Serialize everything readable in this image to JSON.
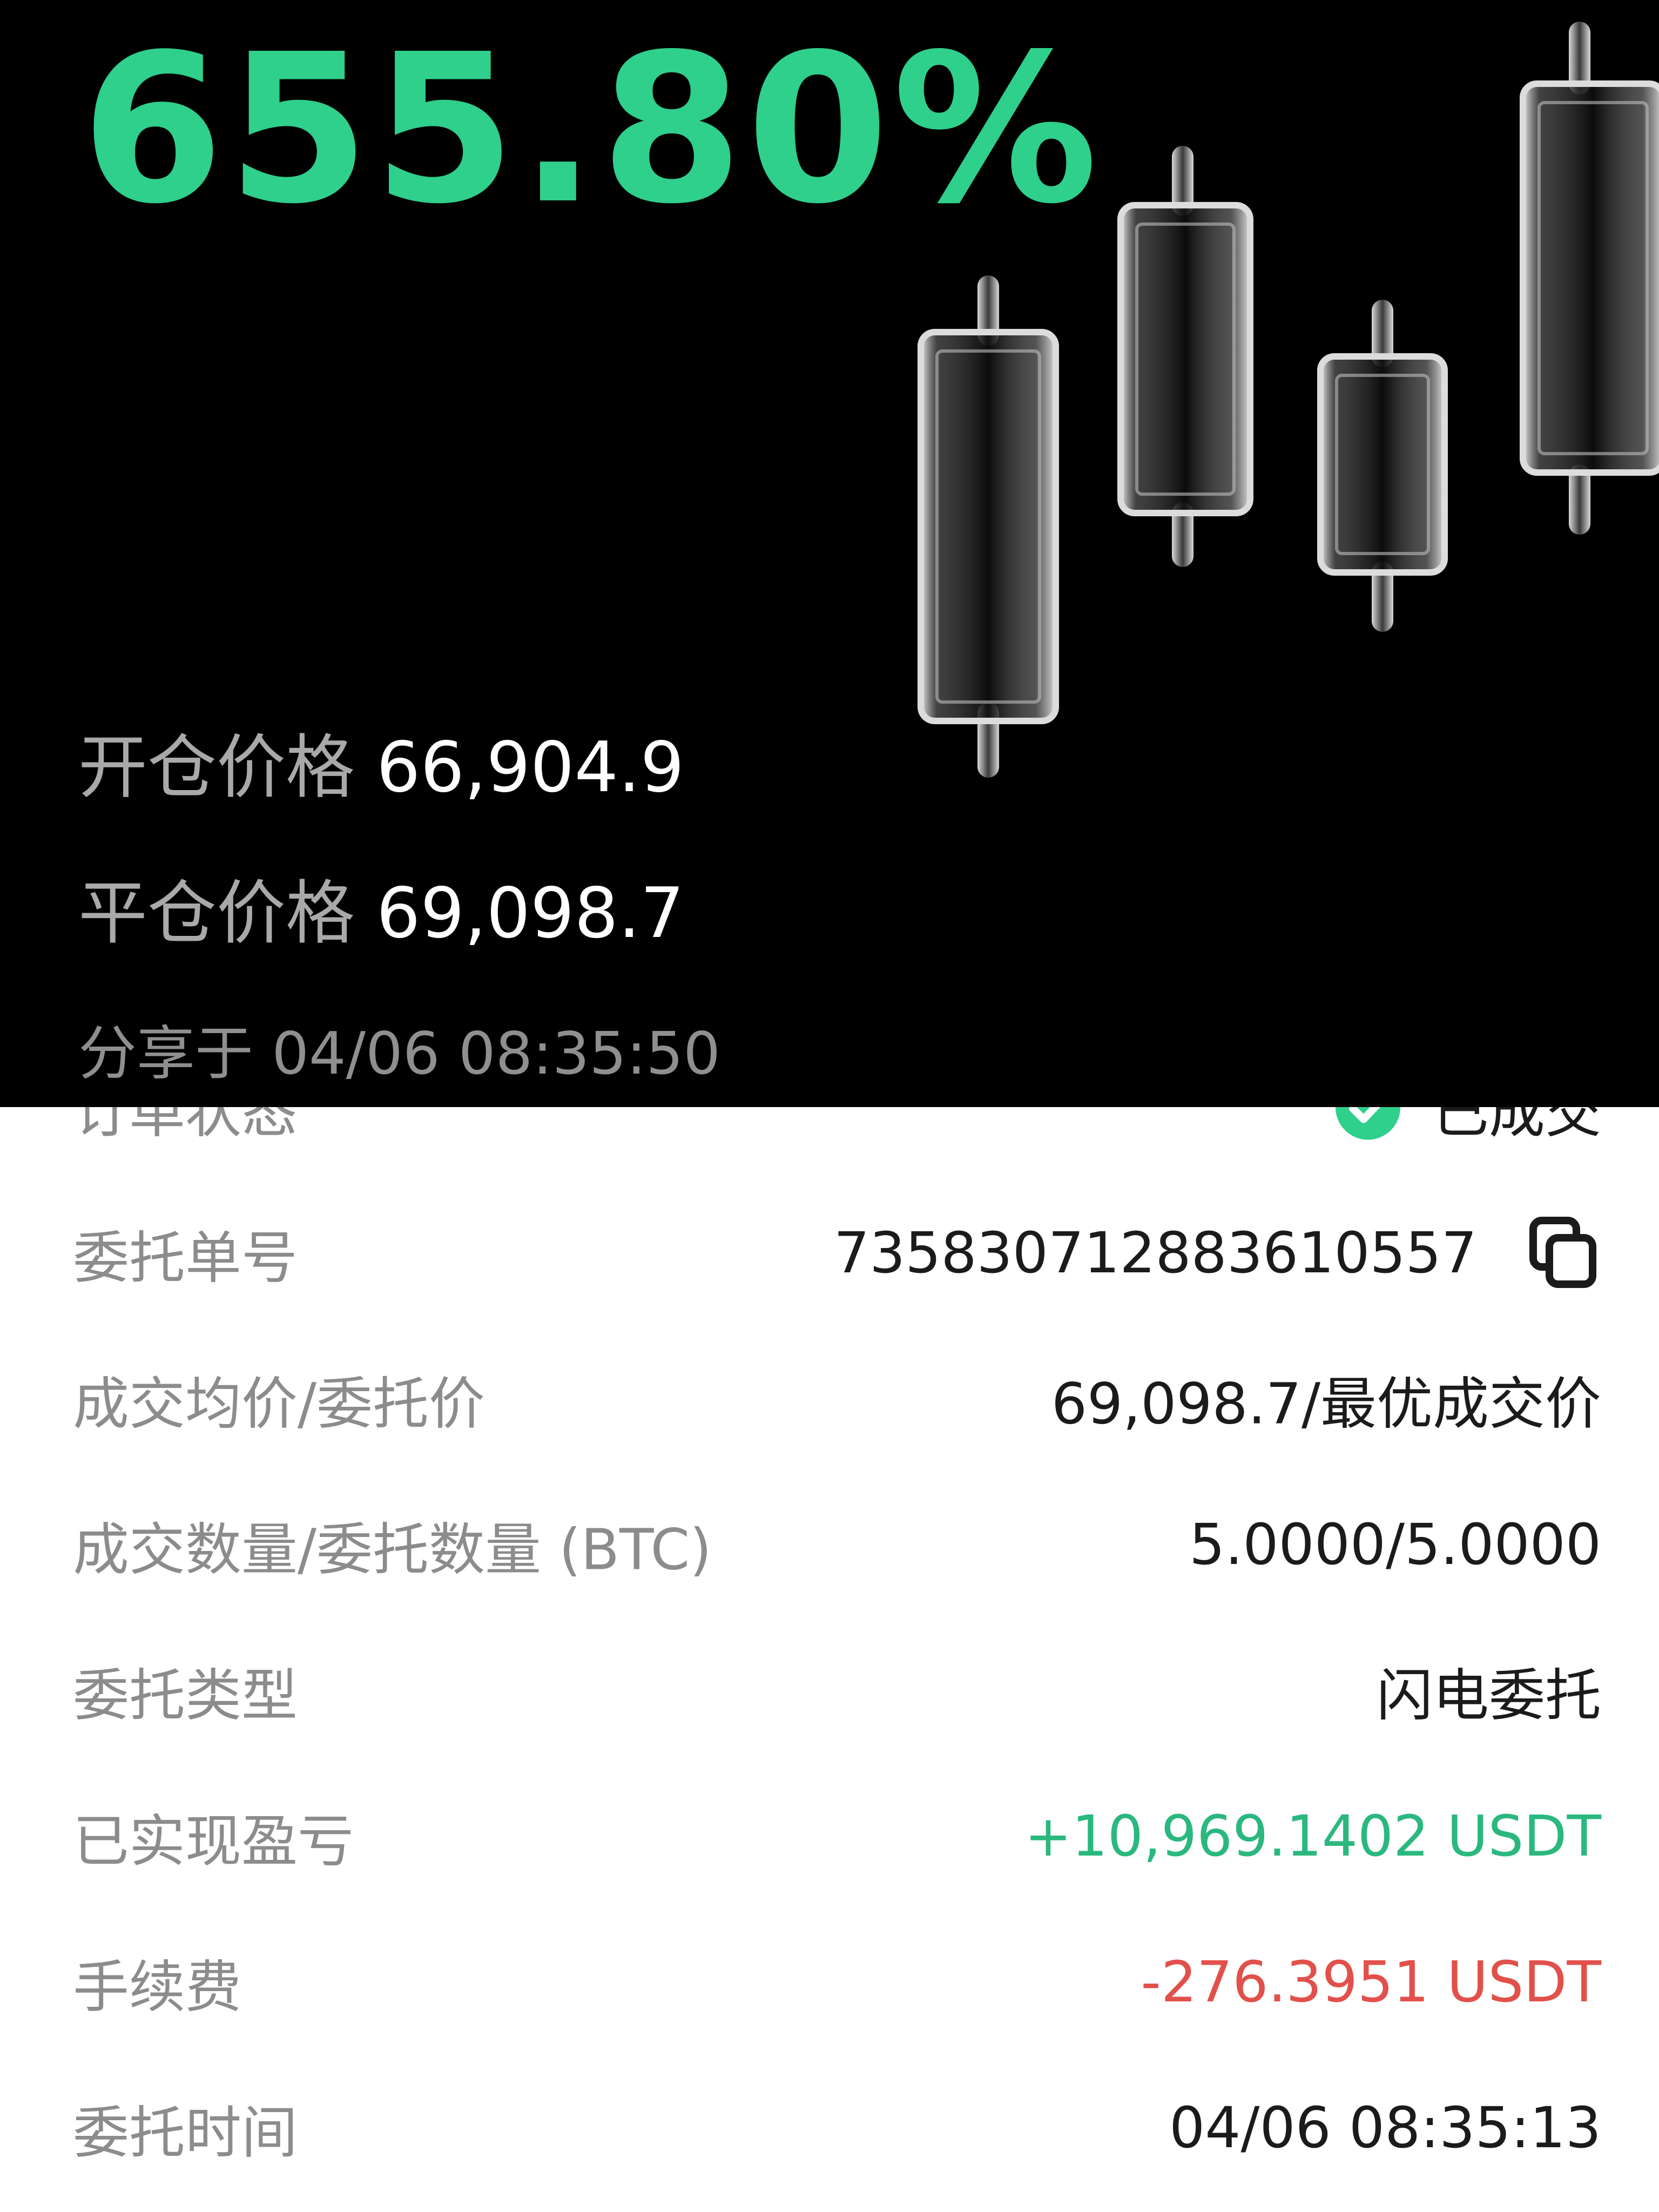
{
  "share_card": {
    "roi": "655.80%",
    "open_price_label": "开仓价格",
    "open_price_value": "66,904.9",
    "close_price_label": "平仓价格",
    "close_price_value": "69,098.7",
    "shared_at": "分享于 04/06 08:35:50"
  },
  "details": {
    "status": {
      "label": "订单状态",
      "value": "已成交",
      "icon": "check-circle-icon"
    },
    "order_id": {
      "label": "委托单号",
      "value": "735830712883610557",
      "icon": "copy-icon"
    },
    "avg_price": {
      "label": "成交均价/委托价",
      "value": "69,098.7/最优成交价"
    },
    "quantity": {
      "label": "成交数量/委托数量 (BTC)",
      "value": "5.0000/5.0000"
    },
    "order_type": {
      "label": "委托类型",
      "value": "闪电委托"
    },
    "realized_pnl": {
      "label": "已实现盈亏",
      "value": "+10,969.1402 USDT"
    },
    "fee": {
      "label": "手续费",
      "value": "-276.3951 USDT"
    },
    "order_time": {
      "label": "委托时间",
      "value": "04/06 08:35:13"
    }
  },
  "colors": {
    "profit": "#2bb87f",
    "loss": "#e2504b",
    "roi": "#2fcf8c",
    "card_bg": "#000000"
  }
}
